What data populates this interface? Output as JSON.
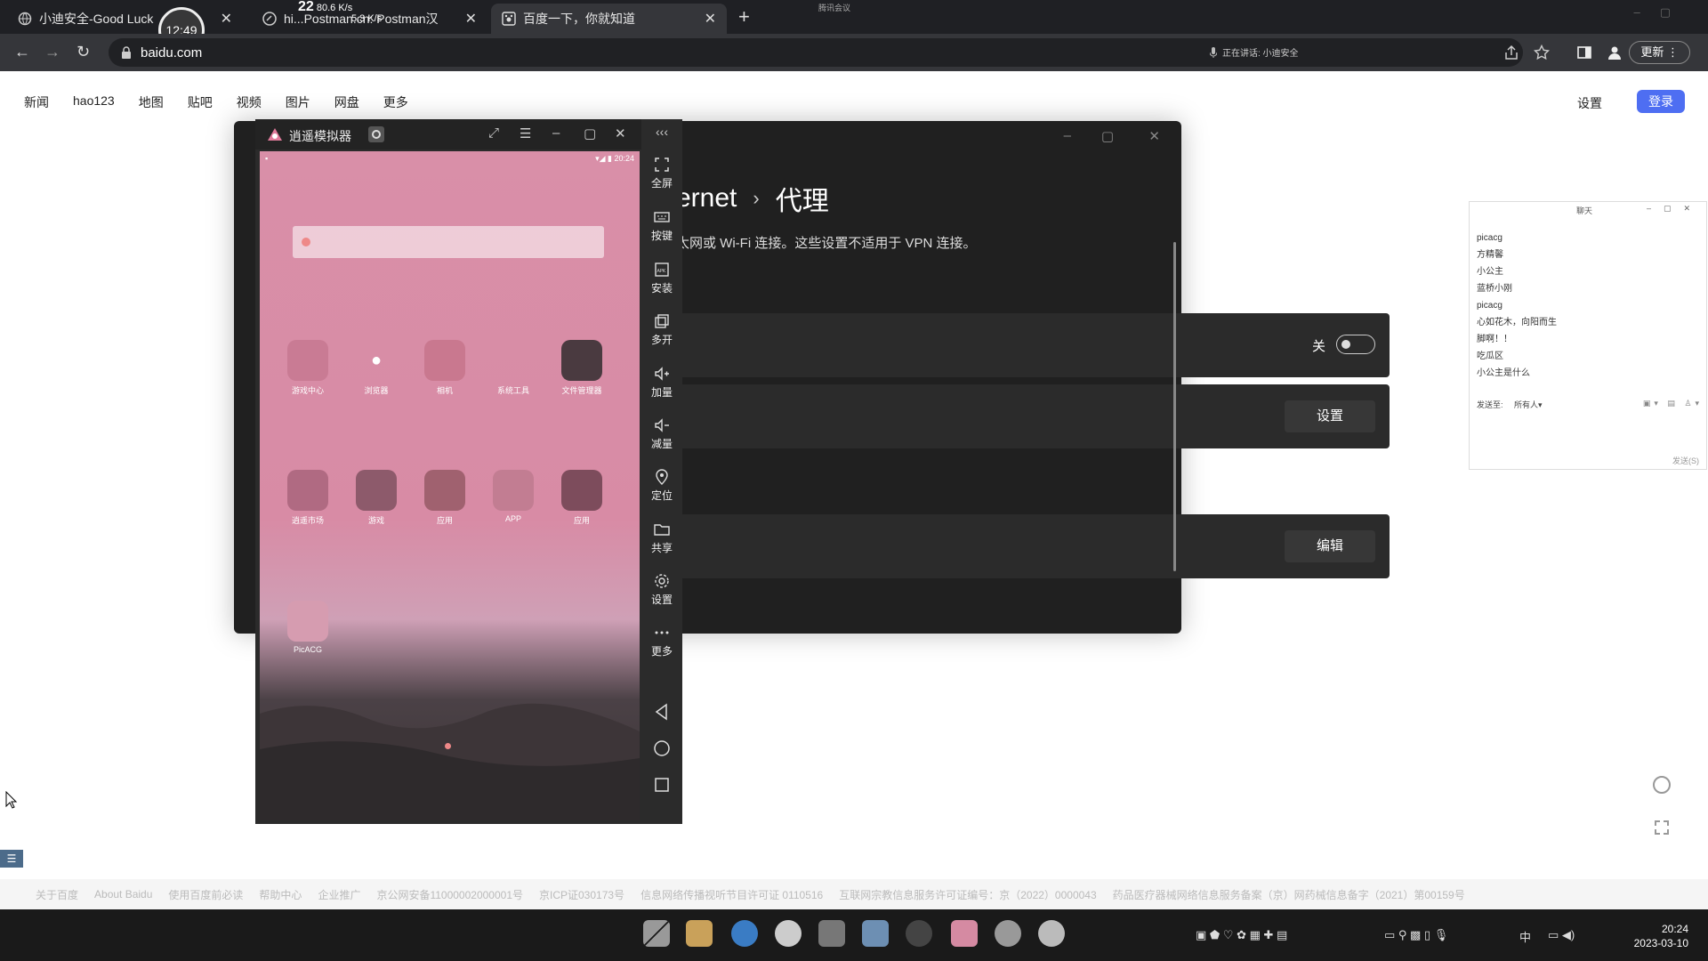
{
  "browser": {
    "tabs": [
      {
        "title": "小迪安全-Good Luck",
        "close": "✕"
      },
      {
        "title": "hi...Postman.cn: Postman汉",
        "close": "✕"
      },
      {
        "title": "百度一下，你就知道",
        "close": "✕"
      }
    ],
    "new_tab": "+",
    "recording_time": "12:49",
    "net_speed_big": "22",
    "net_speed_up": "80.6 K/s",
    "net_speed_down": "5.3 K/s",
    "meeting_label": "腾讯会议",
    "url": "baidu.com",
    "speaking_text": "正在讲话: 小迪安全",
    "update_label": "更新"
  },
  "baidu": {
    "nav": [
      "新闻",
      "hao123",
      "地图",
      "贴吧",
      "视频",
      "图片",
      "网盘",
      "更多"
    ],
    "settings_label": "设置",
    "login_label": "登录",
    "footer_links": [
      "关于百度",
      "About Baidu",
      "使用百度前必读",
      "帮助中心",
      "企业推广",
      "京公网安备11000002000001号",
      "京ICP证030173号",
      "信息网络传播视听节目许可证 0110516",
      "互联网宗教信息服务许可证编号：京（2022）0000043",
      "药品医疗器械网络信息服务备案（京）网药械信息备字（2021）第00159号"
    ]
  },
  "settings_window": {
    "breadcrumb_parent": "ernet",
    "breadcrumb_sep": "›",
    "breadcrumb_current": "代理",
    "description": "太网或 Wi-Fi 连接。这些设置不适用于 VPN 连接。",
    "auto_detect_state": "关",
    "setup_button": "设置",
    "edit_button": "编辑"
  },
  "emulator": {
    "title": "逍遥模拟器",
    "status_right": "▾◢ ▮ 20:24",
    "sidebar": [
      {
        "icon": "fullscreen-icon",
        "label": "全屏"
      },
      {
        "icon": "keyboard-icon",
        "label": "按键"
      },
      {
        "icon": "apk-icon",
        "label": "安装"
      },
      {
        "icon": "multi-instance-icon",
        "label": "多开"
      },
      {
        "icon": "volume-up-icon",
        "label": "加量"
      },
      {
        "icon": "volume-down-icon",
        "label": "减量"
      },
      {
        "icon": "location-icon",
        "label": "定位"
      },
      {
        "icon": "folder-icon",
        "label": "共享"
      },
      {
        "icon": "gear-icon",
        "label": "设置"
      },
      {
        "icon": "more-icon",
        "label": "更多"
      }
    ],
    "apps_row1": [
      "游戏中心",
      "浏览器",
      "相机",
      "系统工具",
      "文件管理器"
    ],
    "apps_row2": [
      "逍遥市场",
      "游戏",
      "应用",
      "APP",
      "应用"
    ],
    "apps_row3": [
      "PicACG"
    ]
  },
  "chat": {
    "title": "聊天",
    "messages": [
      "picacg",
      "方精馨",
      "小公主",
      "蓝桥小刚",
      "picacg",
      "心如花木，向阳而生",
      "脚啊！！",
      "吃瓜区",
      "小公主是什么"
    ],
    "send_to_label": "发送至:",
    "send_to_value": "所有人",
    "send_button": "发送(S)"
  },
  "taskbar": {
    "ime": "中",
    "time": "20:24",
    "date": "2023-03-10"
  },
  "colors": {
    "accent_baidu": "#4e6ef2",
    "settings_bg": "#202020",
    "emulator_screen": "#d98fa8"
  }
}
